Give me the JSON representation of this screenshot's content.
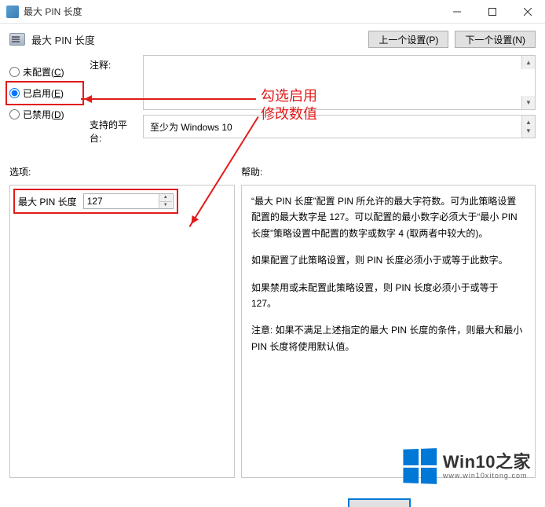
{
  "window": {
    "title": "最大 PIN 长度"
  },
  "header": {
    "title": "最大 PIN 长度",
    "prev_btn": "上一个设置(P)",
    "next_btn": "下一个设置(N)"
  },
  "radios": {
    "not_configured": "未配置(C)",
    "enabled": "已启用(E)",
    "disabled": "已禁用(D)",
    "selected": "enabled"
  },
  "fields": {
    "comment_label": "注释:",
    "platform_label": "支持的平台:",
    "platform_value": "至少为 Windows 10"
  },
  "sections": {
    "options_label": "选项:",
    "help_label": "帮助:"
  },
  "options": {
    "pin_label": "最大 PIN 长度",
    "pin_value": "127"
  },
  "help": {
    "p1": "“最大 PIN 长度”配置 PIN 所允许的最大字符数。可为此策略设置配置的最大数字是 127。可以配置的最小数字必须大于“最小 PIN 长度”策略设置中配置的数字或数字 4 (取两者中较大的)。",
    "p2": "如果配置了此策略设置，则 PIN 长度必须小于或等于此数字。",
    "p3": "如果禁用或未配置此策略设置，则 PIN 长度必须小于或等于 127。",
    "p4": "注意: 如果不满足上述指定的最大 PIN 长度的条件，则最大和最小 PIN 长度将使用默认值。"
  },
  "annotation": {
    "line1": "勾选启用",
    "line2": "修改数值"
  },
  "watermark": {
    "main": "Win10之家",
    "sub": "www.win10xitong.com"
  }
}
